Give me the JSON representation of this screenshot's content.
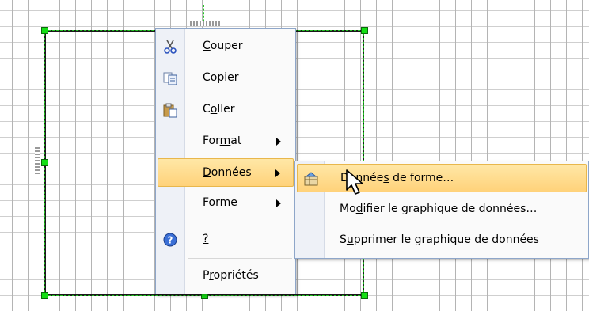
{
  "context_menu": {
    "items": [
      {
        "pre": "",
        "u": "C",
        "post": "ouper",
        "icon": "scissors-icon"
      },
      {
        "pre": "Co",
        "u": "p",
        "post": "ier",
        "icon": "copy-icon"
      },
      {
        "pre": "C",
        "u": "o",
        "post": "ller",
        "icon": "paste-icon"
      },
      {
        "pre": "For",
        "u": "m",
        "post": "at",
        "icon": ""
      },
      {
        "pre": "",
        "u": "D",
        "post": "onnées",
        "icon": ""
      },
      {
        "pre": "Form",
        "u": "e",
        "post": "",
        "icon": ""
      },
      {
        "pre": "",
        "u": "?",
        "post": "",
        "icon": "help-icon"
      },
      {
        "pre": "P",
        "u": "r",
        "post": "opriétés",
        "icon": ""
      }
    ]
  },
  "submenu": {
    "items": [
      {
        "pre": "Donnée",
        "u": "s",
        "post": " de forme…",
        "icon": "shape-data-icon"
      },
      {
        "pre": "Mo",
        "u": "d",
        "post": "ifier le graphique de données…",
        "icon": ""
      },
      {
        "pre": "S",
        "u": "u",
        "post": "pprimer le graphique de données",
        "icon": ""
      }
    ]
  },
  "colors": {
    "highlight": "#ffd27a",
    "selection_handle": "#14e014",
    "menu_border": "#8ea6c9"
  }
}
